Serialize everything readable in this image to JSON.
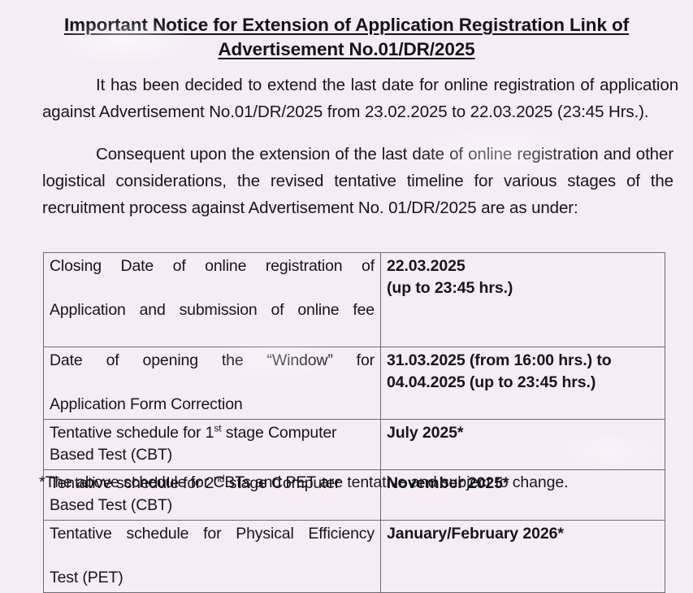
{
  "document": {
    "title_line_1": "Important Notice for Extension of Application Registration Link of",
    "title_line_2": "Advertisement No.01/DR/2025",
    "paragraph_1": "It has been decided to extend the last date for online registration of application against Advertisement No.01/DR/2025 from 23.02.2025 to 22.03.2025 (23:45 Hrs.).",
    "paragraph_2": "Consequent upon the extension of the last date of online registration and other logistical considerations, the revised tentative timeline for various stages of the recruitment process against Advertisement No. 01/DR/2025 are as under:",
    "footnote": "*The above schedule for CBTs and PET are tentative and subject to change."
  },
  "table": {
    "rows": [
      {
        "stage_line_1": "Closing Date of online registration of",
        "stage_line_2": "Application and submission of online fee",
        "justified": true,
        "date_line_1": "22.03.2025",
        "date_line_2": "(up to 23:45 hrs.)"
      },
      {
        "stage_line_1": "Date of opening the “Window” for",
        "stage_line_2": "Application Form Correction",
        "justified": true,
        "date_line_1": "31.03.2025 (from 16:00 hrs.)  to",
        "date_line_2": "04.04.2025 (up to 23:45 hrs.)"
      },
      {
        "stage_prefix": "Tentative schedule for 1",
        "stage_ordinal": "st",
        "stage_suffix": " stage Computer",
        "stage_line_2": "Based Test (CBT)",
        "justified": false,
        "date_line_1": "July 2025*",
        "date_line_2": ""
      },
      {
        "stage_prefix": "Tentative schedule for 2",
        "stage_ordinal": "nd",
        "stage_suffix": " stage Computer",
        "stage_line_2": "Based Test (CBT)",
        "justified": false,
        "date_line_1": "November 2025*",
        "date_line_2": ""
      },
      {
        "stage_line_1": "Tentative schedule for Physical Efficiency",
        "stage_line_2": "Test (PET)",
        "justified": true,
        "date_line_1": "January/February 2026*",
        "date_line_2": ""
      }
    ]
  },
  "colors": {
    "page_background": "#f6ecf6",
    "text": "#17151a",
    "table_border": "#6d6b73"
  }
}
